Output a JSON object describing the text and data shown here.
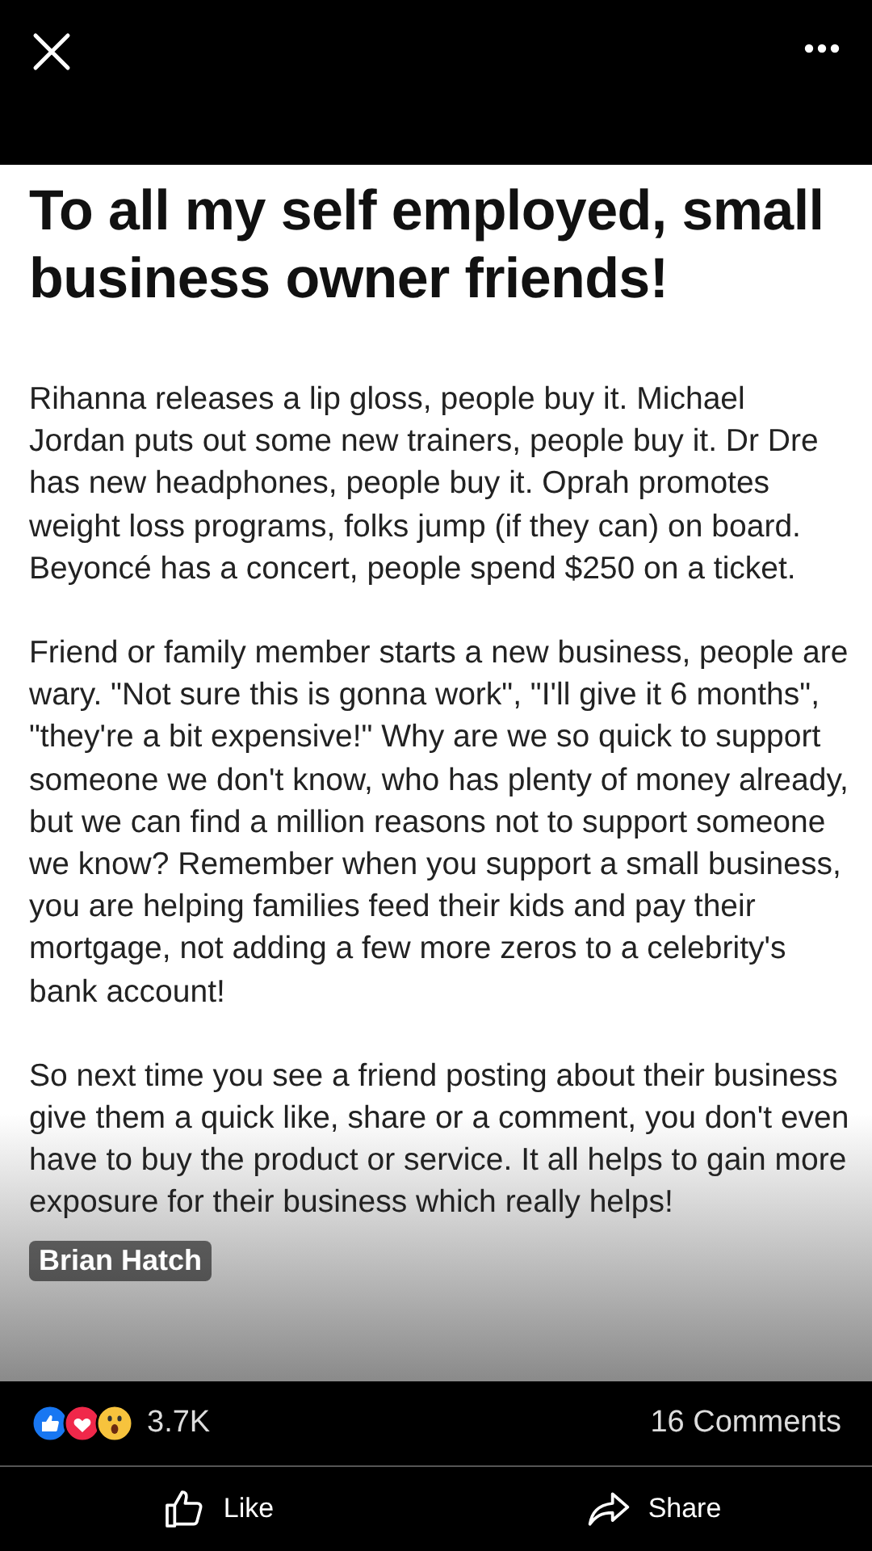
{
  "post_image": {
    "title": "To all my self employed, small business owner friends!",
    "paragraphs": [
      "Rihanna releases a lip gloss, people buy it. Michael Jordan puts out some new trainers, people buy it. Dr Dre has new headphones, people buy it. Oprah promotes weight loss programs, folks jump (if they can) on board. Beyoncé has a concert, people spend $250 on a ticket.",
      "Friend or family member starts a new business, people are wary. \"Not sure this is gonna work\", \"I'll give it 6 months\", \"they're a bit expensive!\" Why are we so quick to support someone we don't know, who has plenty of money already, but we can find a million reasons not to support someone we know? Remember when you support a small business, you are helping families feed their kids and pay their mortgage, not adding a few more zeros to a celebrity's bank account!",
      "So next time you see a friend posting about their business give them a quick like, share or a comment, you don't even have to buy the product or service. It all helps to gain more exposure for their business which really helps!"
    ]
  },
  "author": "Brian Hatch",
  "reactions": {
    "count": "3.7K",
    "comments": "16 Comments"
  },
  "actions": [
    {
      "kind": "like",
      "label": "Like"
    },
    {
      "kind": "share",
      "label": "Share"
    }
  ]
}
